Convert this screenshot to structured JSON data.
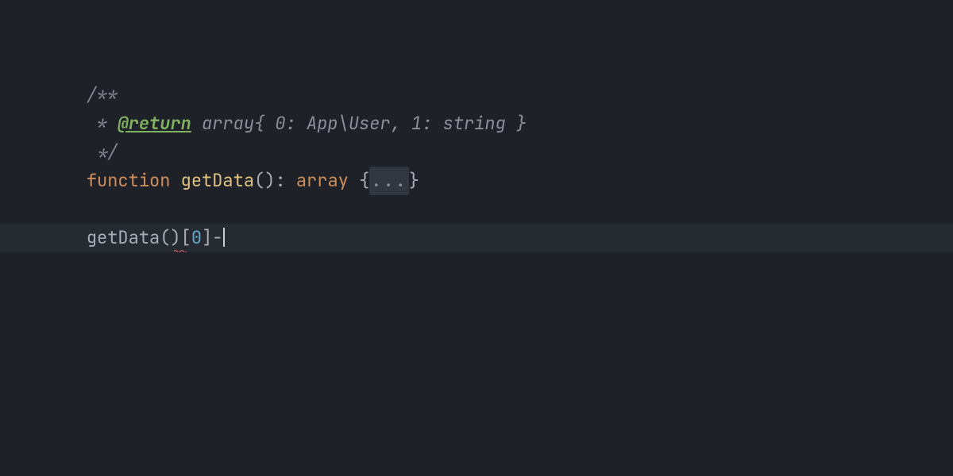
{
  "code": {
    "line1": {
      "open": "/**"
    },
    "line2": {
      "prefix": " * ",
      "tag": "@return",
      "type": " array{ 0: App\\User, 1: string }"
    },
    "line3": {
      "close": " */"
    },
    "line4": {
      "keyword": "function",
      "space1": " ",
      "fn": "getData",
      "parens": "()",
      "colon": ": ",
      "type": "array",
      "space2": " ",
      "brace_open": "{",
      "folded": "...",
      "brace_close": "}"
    },
    "line6": {
      "call": "getData",
      "parens": "()",
      "bracket_open": "[",
      "index": "0",
      "bracket_close": "]",
      "dash": "-"
    }
  }
}
